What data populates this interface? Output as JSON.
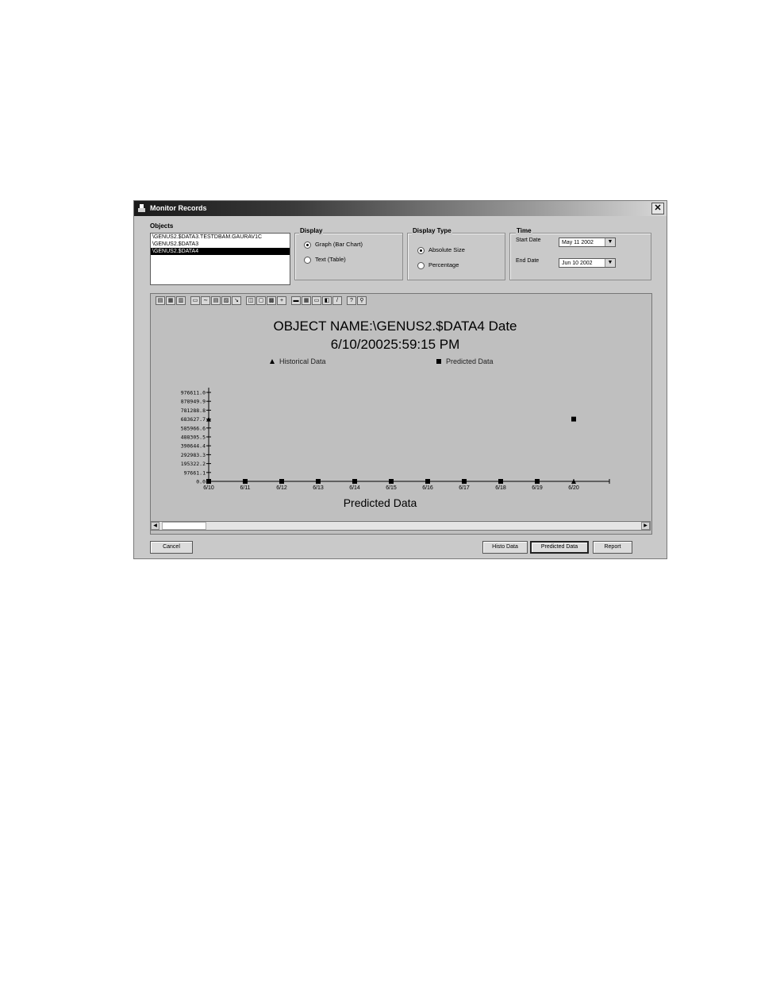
{
  "window": {
    "title": "Monitor Records",
    "close_label": "✕"
  },
  "objects": {
    "label": "Objects",
    "items": [
      "\\GENUS2.$DATA3.TESTDBAM.GAURAV1C",
      "\\GENUS2.$DATA3",
      "\\GENUS2.$DATA4"
    ],
    "selected_index": 2
  },
  "display": {
    "label": "Display",
    "options": [
      "Graph (Bar Chart)",
      "Text (Table)"
    ],
    "selected_index": 0
  },
  "display_type": {
    "label": "Display Type",
    "options": [
      "Absolute Size",
      "Percentage"
    ],
    "selected_index": 0
  },
  "time": {
    "label": "Time",
    "start_label": "Start Date",
    "start_value": "May 11 2002",
    "end_label": "End Date",
    "end_value": "Jun 10 2002"
  },
  "chart_data": {
    "type": "scatter",
    "title_line1": "OBJECT NAME:\\GENUS2.$DATA4   Date",
    "title_line2": "6/10/20025:59:15 PM",
    "xlabel": "Predicted Data",
    "categories": [
      "6/10",
      "6/11",
      "6/12",
      "6/13",
      "6/14",
      "6/15",
      "6/16",
      "6/17",
      "6/18",
      "6/19",
      "6/20"
    ],
    "y_ticks": [
      "0.0",
      "97661.1",
      "195322.2",
      "292983.3",
      "390644.4",
      "488305.5",
      "585966.6",
      "683627.7",
      "781288.8",
      "878949.9",
      "976611.0"
    ],
    "ylim": [
      0,
      976611.0
    ],
    "legend_position": "top",
    "series": [
      {
        "name": "Historical Data",
        "marker": "triangle",
        "values": [
          683627.7,
          null,
          null,
          null,
          null,
          null,
          null,
          null,
          null,
          null,
          0
        ]
      },
      {
        "name": "Predicted Data",
        "marker": "square",
        "values": [
          0,
          0,
          0,
          0,
          0,
          0,
          0,
          0,
          0,
          0,
          683627.7
        ]
      }
    ],
    "background": "#bfbfbf"
  },
  "buttons": {
    "cancel": "Cancel",
    "histo": "Histo Data",
    "predicted": "Predicted Data",
    "report": "Report"
  }
}
